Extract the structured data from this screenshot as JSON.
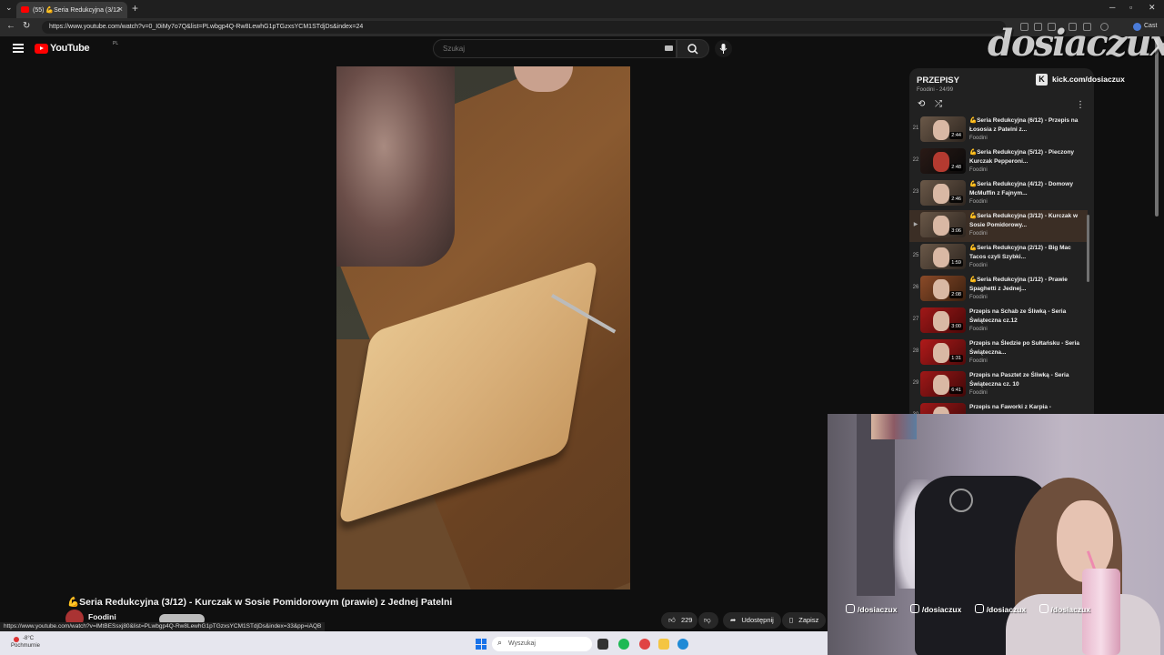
{
  "browser": {
    "tab_title": "(55) 💪Seria Redukcyjna (3/12",
    "new_tab_label": "+",
    "url": "https://www.youtube.com/watch?v=0_I0iMy7o7Q&list=PLwbgp4Q-Rw8LewhG1pTGzxsYCM1STdjDs&index=24",
    "cast_label": "Cast"
  },
  "youtube": {
    "logo_text": "YouTube",
    "region": "PL",
    "search_placeholder": "Szukaj"
  },
  "video": {
    "title": "💪Seria Redukcyjna (3/12) - Kurczak w Sosie Pomidorowym (prawie) z Jednej Patelni",
    "channel": "Foodini",
    "likes": "229",
    "share_label": "Udostępnij",
    "save_label": "Zapisz"
  },
  "status_url": "https://www.youtube.com/watch?v=lMtBESsxj80&list=PLwbgp4Q-Rw8LewhG1pTGzxsYCM1STdjDs&index=33&pp=iAQB",
  "taskbar": {
    "temp": "-8°C",
    "weather_desc": "Pochmurnie",
    "search_placeholder": "Wyszukaj",
    "weather_badge": "3"
  },
  "playlist": {
    "title": "PRZEPISY",
    "subtitle": "Foodini - 24/99",
    "items": [
      {
        "index": "21",
        "title": "💪Seria Redukcyjna (6/12) - Przepis na Łososia z Patelni z...",
        "channel": "Foodini",
        "duration": "2:44"
      },
      {
        "index": "22",
        "title": "💪Seria Redukcyjna (5/12) - Pieczony Kurczak Pepperoni...",
        "channel": "Foodini",
        "duration": "2:48"
      },
      {
        "index": "23",
        "title": "💪Seria Redukcyjna (4/12) - Domowy McMuffin z Fajnym...",
        "channel": "Foodini",
        "duration": "2:46"
      },
      {
        "index": "▶",
        "title": "💪Seria Redukcyjna (3/12) - Kurczak w Sosie Pomidorowy...",
        "channel": "Foodini",
        "duration": "3:06"
      },
      {
        "index": "25",
        "title": "💪Seria Redukcyjna (2/12) - Big Mac Tacos czyli Szybki...",
        "channel": "Foodini",
        "duration": "1:59"
      },
      {
        "index": "26",
        "title": "💪Seria Redukcyjna (1/12) - Prawie Spaghetti z Jednej...",
        "channel": "Foodini",
        "duration": "2:08"
      },
      {
        "index": "27",
        "title": "Przepis na Schab ze Śliwką - Seria Świąteczna cz.12",
        "channel": "Foodini",
        "duration": "3:00"
      },
      {
        "index": "28",
        "title": "Przepis na Śledzie po Sułtańsku - Seria Świąteczna...",
        "channel": "Foodini",
        "duration": "1:31"
      },
      {
        "index": "29",
        "title": "Przepis na Pasztet ze Śliwką - Seria Świąteczna cz. 10",
        "channel": "Foodini",
        "duration": "6:41"
      },
      {
        "index": "30",
        "title": "Przepis na Faworki z Karpia -",
        "channel": "",
        "duration": ""
      }
    ]
  },
  "overlay": {
    "brand": "dosiaczux",
    "kick": "kick.com/dosiaczux",
    "socials": [
      "/dosiaczux",
      "/dosiaczux",
      "/dosiaczux",
      "/dosiaczux"
    ]
  }
}
